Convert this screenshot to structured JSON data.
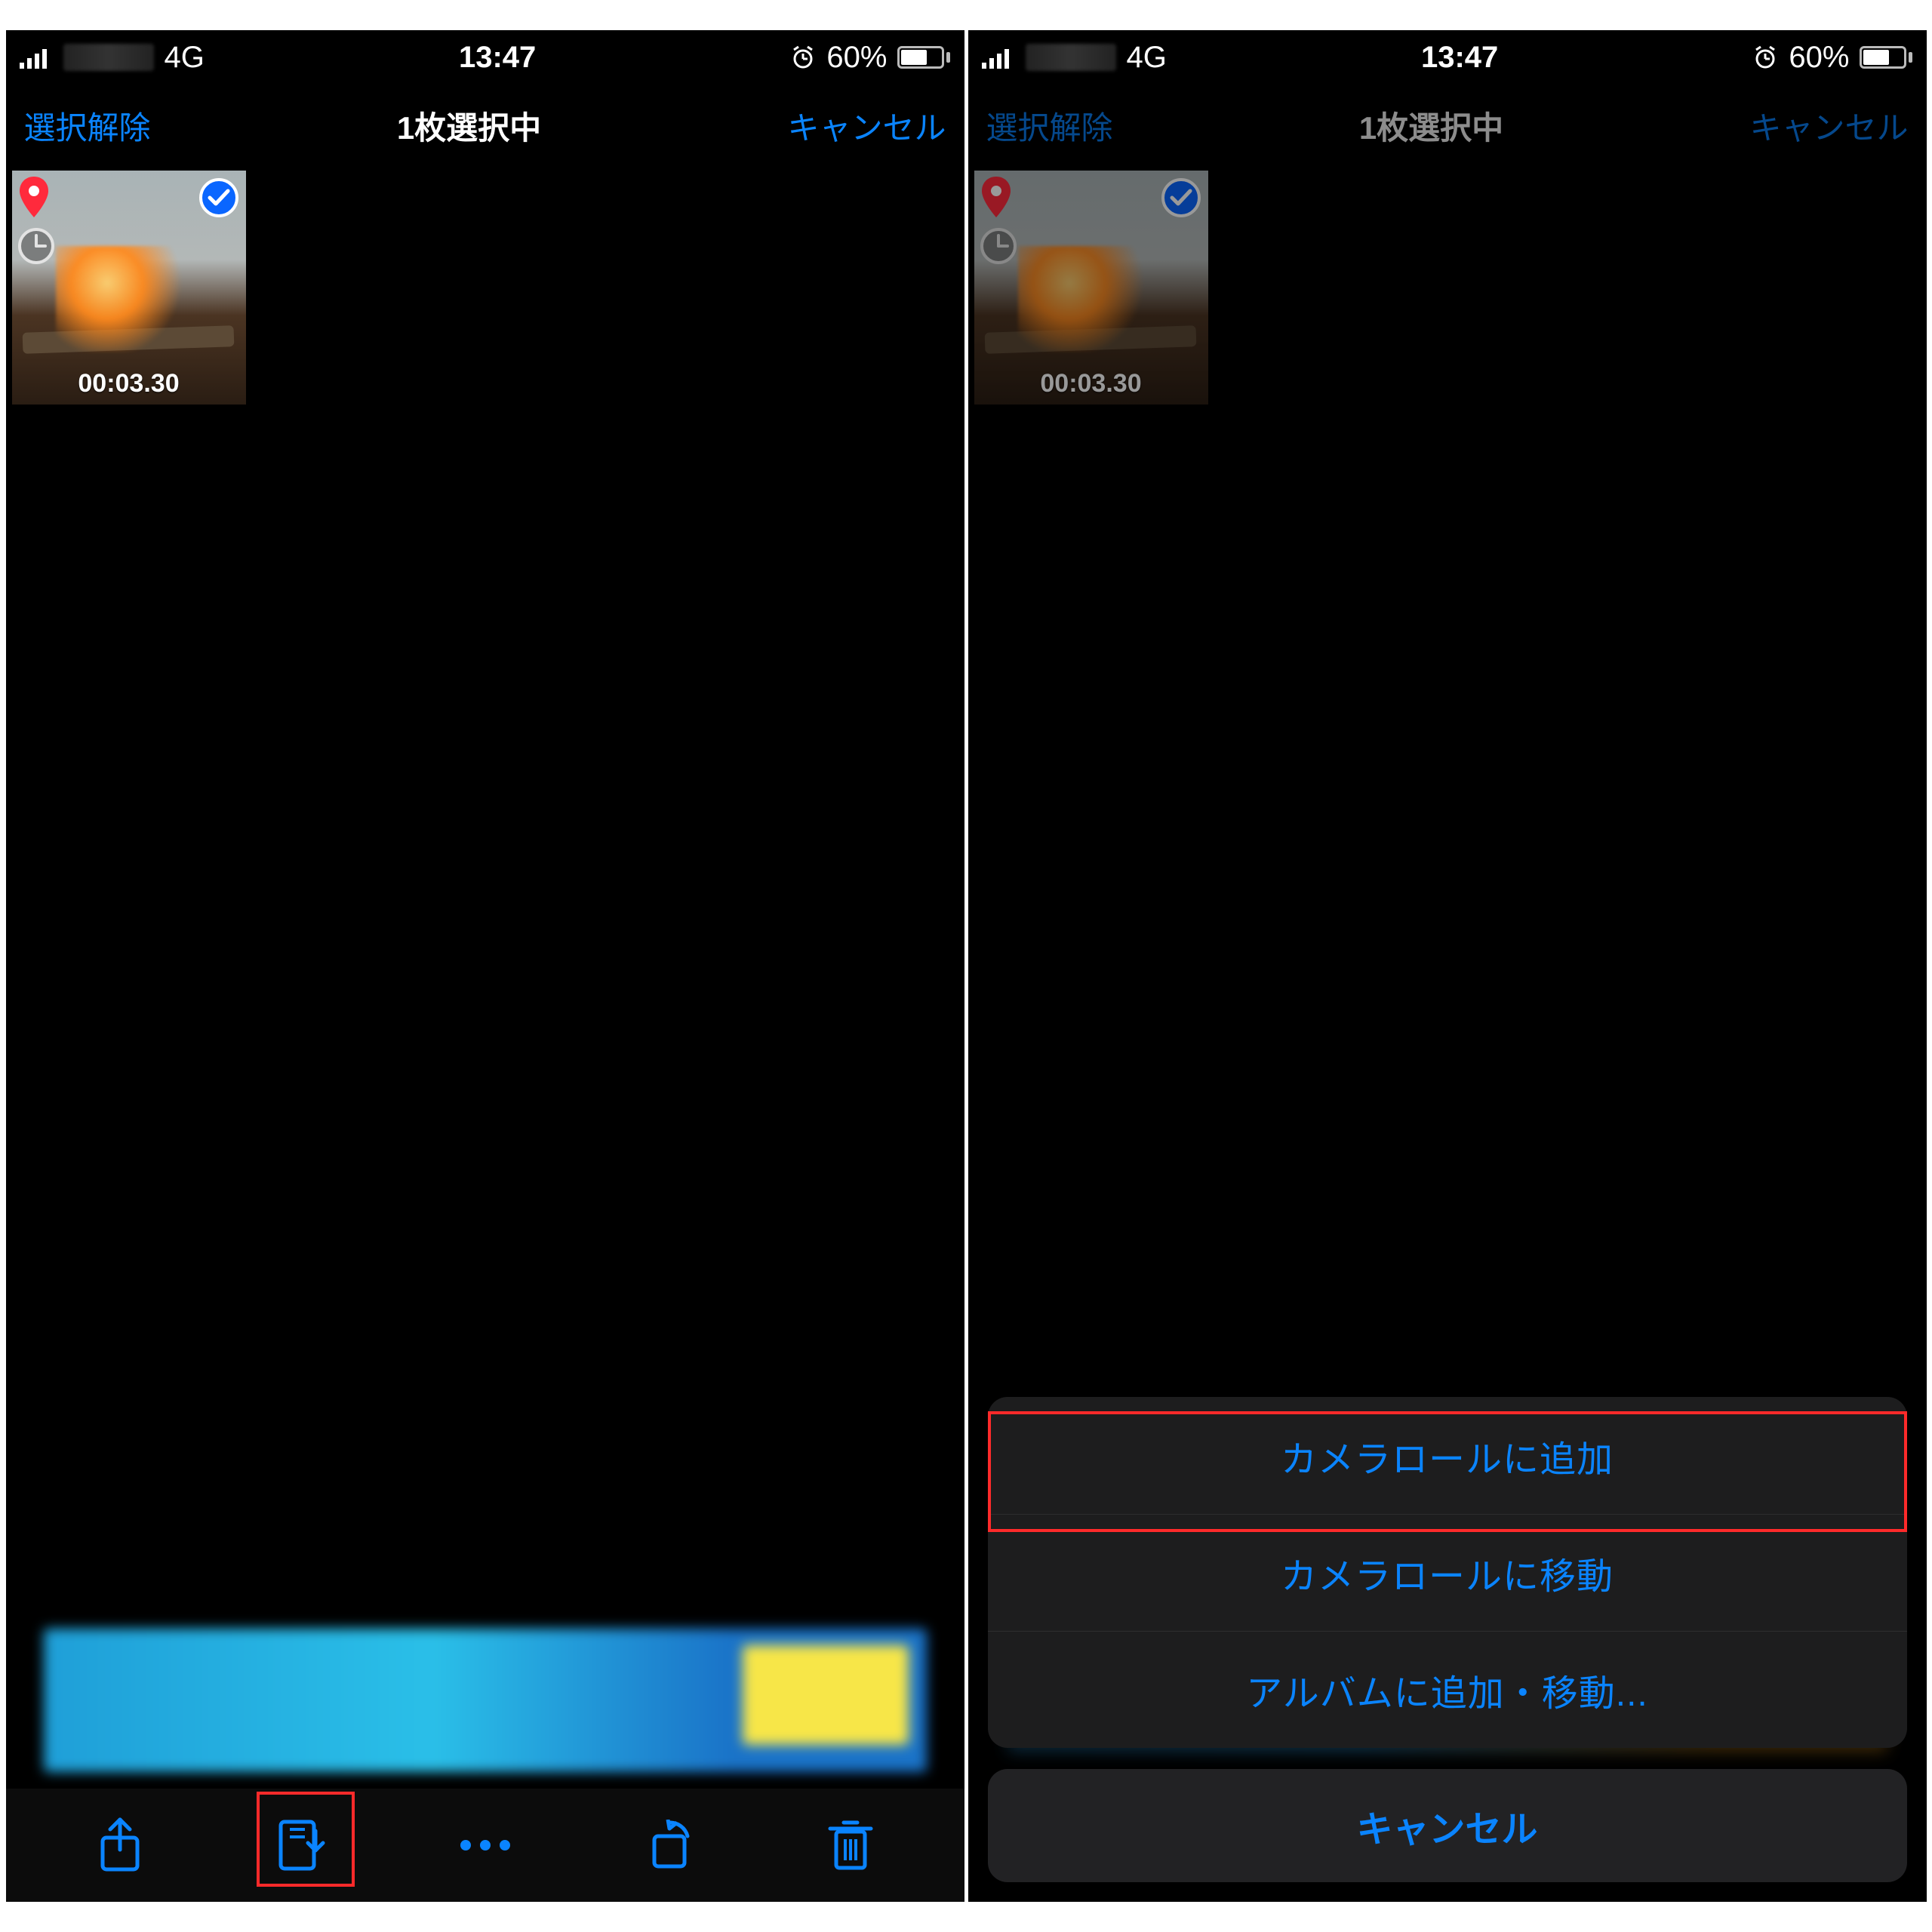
{
  "status": {
    "network": "4G",
    "time": "13:47",
    "battery_percent": "60%"
  },
  "nav": {
    "left": "選択解除",
    "title": "1枚選択中",
    "right": "キャンセル"
  },
  "thumb": {
    "duration": "00:03.30"
  },
  "sheet": {
    "items": [
      "カメラロールに追加",
      "カメラロールに移動",
      "アルバムに追加・移動..."
    ],
    "cancel": "キャンセル"
  }
}
